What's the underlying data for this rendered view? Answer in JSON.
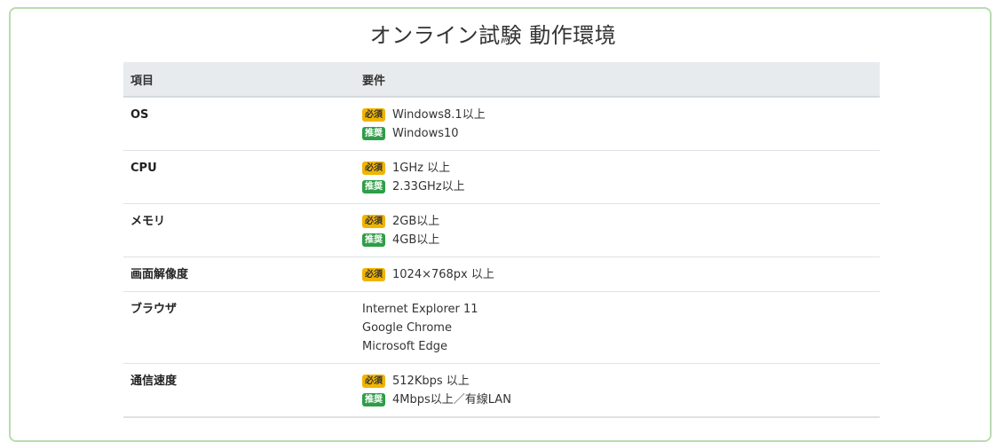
{
  "title": "オンライン試験 動作環境",
  "table": {
    "headers": {
      "item": "項目",
      "requirement": "要件"
    },
    "badges": {
      "required": "必須",
      "recommended": "推奨"
    },
    "rows": [
      {
        "item": "OS",
        "lines": [
          {
            "badge": "必須",
            "text": "Windows8.1以上"
          },
          {
            "badge": "推奨",
            "text": "Windows10"
          }
        ]
      },
      {
        "item": "CPU",
        "lines": [
          {
            "badge": "必須",
            "text": "1GHz 以上"
          },
          {
            "badge": "推奨",
            "text": "2.33GHz以上"
          }
        ]
      },
      {
        "item": "メモリ",
        "lines": [
          {
            "badge": "必須",
            "text": "2GB以上"
          },
          {
            "badge": "推奨",
            "text": "4GB以上"
          }
        ]
      },
      {
        "item": "画面解像度",
        "lines": [
          {
            "badge": "必須",
            "text": "1024×768px 以上"
          }
        ]
      },
      {
        "item": "ブラウザ",
        "lines": [
          {
            "text": "Internet Explorer 11"
          },
          {
            "text": "Google Chrome"
          },
          {
            "text": "Microsoft Edge"
          }
        ]
      },
      {
        "item": "通信速度",
        "lines": [
          {
            "badge": "必須",
            "text": "512Kbps 以上"
          },
          {
            "badge": "推奨",
            "text": "4Mbps以上／有線LAN"
          }
        ]
      }
    ]
  },
  "colors": {
    "panel_border": "#b9dbb0",
    "header_bg": "#e8ebee",
    "required_badge": "#f0b400",
    "recommended_badge": "#2e9e47"
  }
}
